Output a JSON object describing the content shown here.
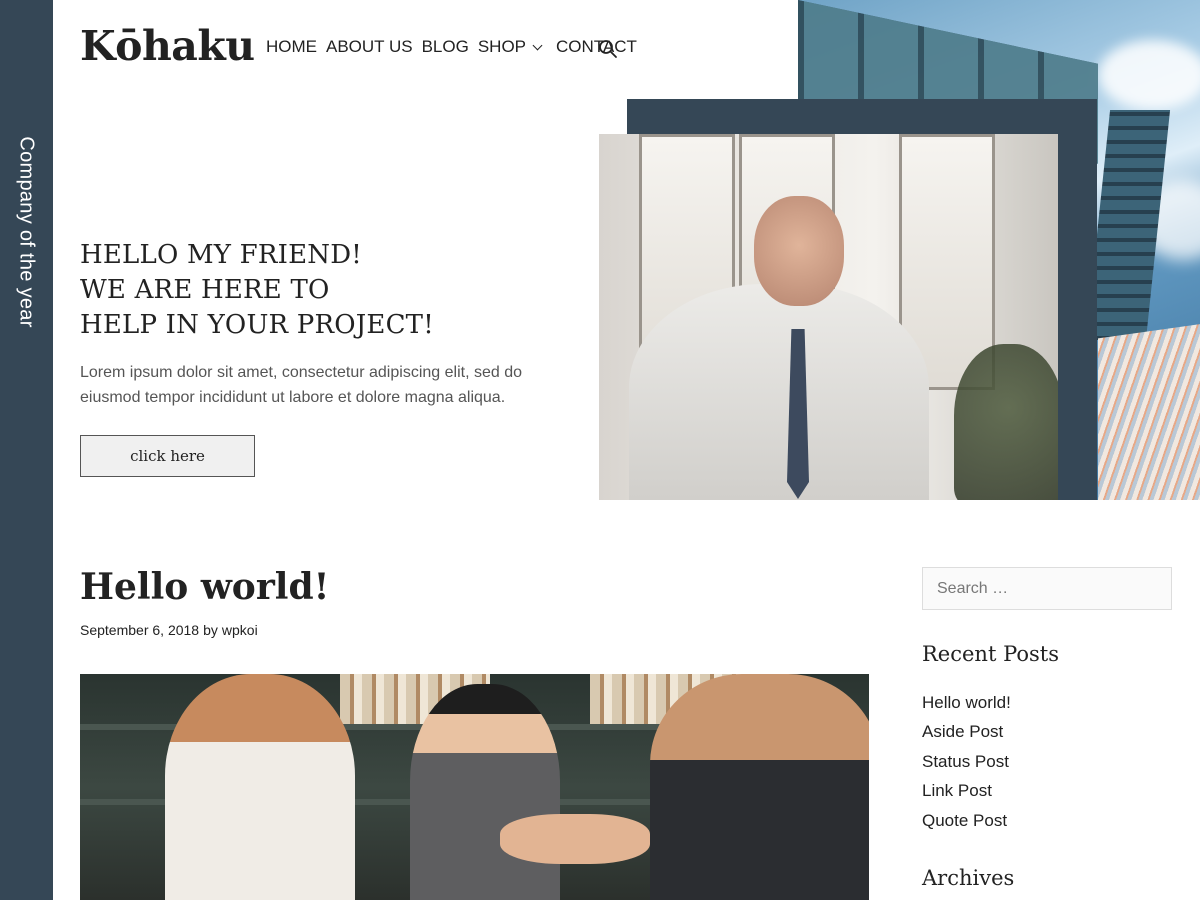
{
  "site": {
    "logo": "Kōhaku",
    "side_label": "Company of the year"
  },
  "nav": {
    "items": [
      "HOME",
      "ABOUT US",
      "BLOG",
      "SHOP",
      "CONTACT"
    ],
    "shop_has_dropdown": true,
    "search_icon": "search-icon"
  },
  "hero": {
    "title_lines": [
      "HELLO MY FRIEND!",
      "WE ARE HERE TO",
      "HELP IN YOUR PROJECT!"
    ],
    "text": "Lorem ipsum dolor sit amet, consectetur adipiscing elit, sed do eiusmod tempor incididunt ut labore et dolore magna aliqua.",
    "button_label": "click here"
  },
  "post": {
    "title": "Hello world!",
    "date": "September 6, 2018",
    "by": "by",
    "author": "wpkoi"
  },
  "sidebar": {
    "search_placeholder": "Search …",
    "recent_title": "Recent Posts",
    "recent_posts": [
      "Hello world!",
      "Aside Post",
      "Status Post",
      "Link Post",
      "Quote Post"
    ],
    "archives_title": "Archives"
  },
  "colors": {
    "accent_dark": "#354756",
    "text": "#222222",
    "muted_text": "#555555"
  }
}
